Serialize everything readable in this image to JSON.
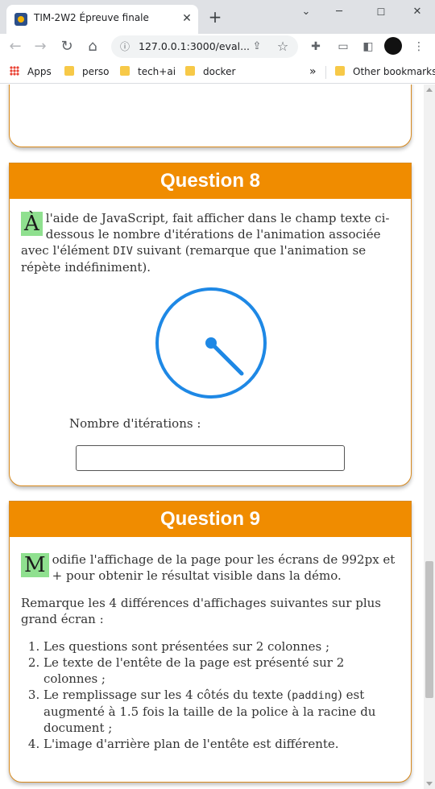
{
  "browser": {
    "tab_title": "TIM-2W2 Épreuve finale",
    "url": "127.0.0.1:3000/eval...",
    "bookmarks": [
      {
        "label": "Apps",
        "icon": "apps-grid-icon"
      },
      {
        "label": "perso",
        "icon": "folder-icon"
      },
      {
        "label": "tech+ai",
        "icon": "folder-icon"
      },
      {
        "label": "docker",
        "icon": "folder-icon"
      }
    ],
    "overflow_label": "»",
    "other_bookmarks": "Other bookmarks"
  },
  "q8": {
    "title": "Question 8",
    "dropcap": "À",
    "text": " l'aide de JavaScript, fait afficher dans le champ texte ci-dessous le nombre d'itérations de l'animation associée avec l'élément ",
    "code": "DIV",
    "text_after": " suivant (remarque que l'animation se répète indéfiniment).",
    "input_label": "Nombre d'itérations :",
    "input_value": "",
    "accent_color": "#f08c00",
    "clock_color": "#1e88e5"
  },
  "q9": {
    "title": "Question 9",
    "dropcap": "M",
    "intro": "odifie l'affichage de la page pour les écrans de 992px et + pour obtenir le résultat visible dans la démo.",
    "remark": "Remarque les 4 différences d'affichages suivantes sur plus grand écran :",
    "items": [
      {
        "before": "Les questions sont présentées sur 2 colonnes ;",
        "code": "",
        "after": ""
      },
      {
        "before": "Le texte de l'entête de la page est présenté sur 2 colonnes ;",
        "code": "",
        "after": ""
      },
      {
        "before": "Le remplissage sur les 4 côtés du texte (",
        "code": "padding",
        "after": ") est augmenté à 1.5 fois la taille de la police à la racine du document ;"
      },
      {
        "before": "L'image d'arrière plan de l'entête est différente.",
        "code": "",
        "after": ""
      }
    ]
  }
}
